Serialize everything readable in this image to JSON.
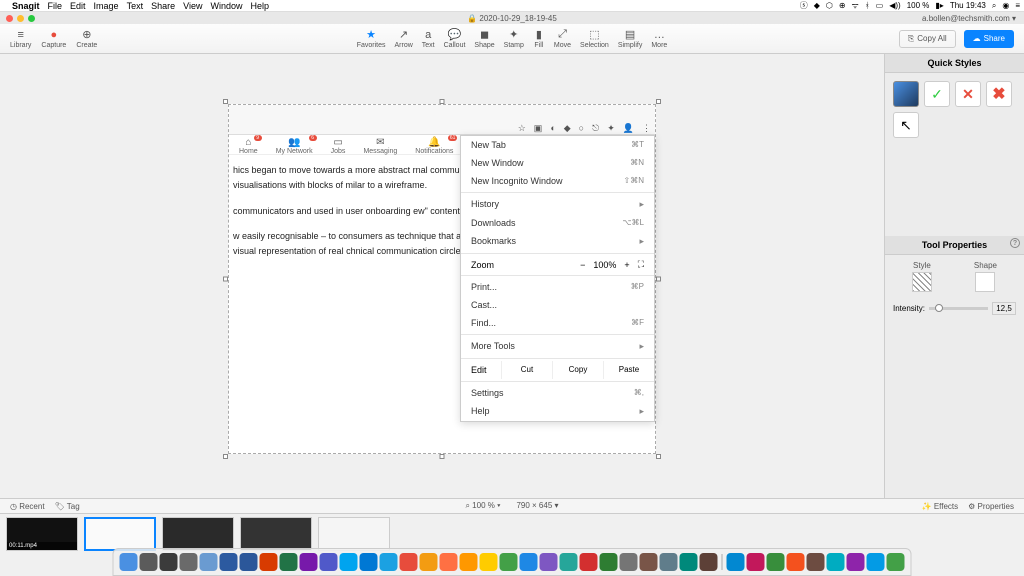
{
  "mac_menubar": {
    "app_name": "Snagit",
    "items": [
      "File",
      "Edit",
      "Image",
      "Text",
      "Share",
      "View",
      "Window",
      "Help"
    ],
    "right": {
      "battery": "100 %",
      "time": "Thu 19:43"
    }
  },
  "title_bar": {
    "title": "2020-10-29_18-19-45",
    "account": "a.bollen@techsmith.com ▾"
  },
  "toolbar": {
    "left": [
      {
        "icon": "≡",
        "label": "Library"
      },
      {
        "icon": "●",
        "label": "Capture",
        "color": "#e74c3c"
      },
      {
        "icon": "⊕",
        "label": "Create"
      }
    ],
    "center": [
      {
        "icon": "★",
        "label": "Favorites",
        "color": "#0a84ff"
      },
      {
        "icon": "↗",
        "label": "Arrow"
      },
      {
        "icon": "a",
        "label": "Text"
      },
      {
        "icon": "💬",
        "label": "Callout"
      },
      {
        "icon": "◼",
        "label": "Shape"
      },
      {
        "icon": "✦",
        "label": "Stamp"
      },
      {
        "icon": "▮",
        "label": "Fill"
      },
      {
        "icon": "⤢",
        "label": "Move"
      },
      {
        "icon": "⬚",
        "label": "Selection"
      },
      {
        "icon": "▤",
        "label": "Simplify"
      },
      {
        "icon": "…",
        "label": "More"
      }
    ],
    "copy_all": "Copy All",
    "share": "Share"
  },
  "right_panel": {
    "quick_styles_title": "Quick Styles",
    "tool_props_title": "Tool Properties",
    "style_label": "Style",
    "shape_label": "Shape",
    "intensity_label": "Intensity:",
    "intensity_value": "12,5"
  },
  "canvas": {
    "linkedin_nav": [
      {
        "label": "Home",
        "badge": "9"
      },
      {
        "label": "My Network",
        "badge": "6"
      },
      {
        "label": "Jobs",
        "badge": ""
      },
      {
        "label": "Messaging",
        "badge": ""
      },
      {
        "label": "Notifications",
        "badge": "61"
      }
    ],
    "paragraphs": [
      "hics began to move towards a more abstract rnal communications, especially among y simple visualisations with blocks of milar to a wireframe.",
      "communicators and used in user onboarding ew\" content, making its way into classic",
      "w easily recognisable – to consumers as technique that a lot of companies are using, out, simplified visual representation of real chnical communication circles it came to be"
    ]
  },
  "chrome_menu": {
    "items": [
      {
        "label": "New Tab",
        "shortcut": "⌘T"
      },
      {
        "label": "New Window",
        "shortcut": "⌘N"
      },
      {
        "label": "New Incognito Window",
        "shortcut": "⇧⌘N"
      }
    ],
    "group2": [
      {
        "label": "History",
        "arrow": "▸"
      },
      {
        "label": "Downloads",
        "shortcut": "⌥⌘L"
      },
      {
        "label": "Bookmarks",
        "arrow": "▸"
      }
    ],
    "zoom": {
      "label": "Zoom",
      "minus": "−",
      "value": "100%",
      "plus": "+",
      "full": "⛶"
    },
    "group3": [
      {
        "label": "Print...",
        "shortcut": "⌘P"
      },
      {
        "label": "Cast..."
      },
      {
        "label": "Find...",
        "shortcut": "⌘F"
      }
    ],
    "more_tools": {
      "label": "More Tools",
      "arrow": "▸"
    },
    "edit": {
      "label": "Edit",
      "cut": "Cut",
      "copy": "Copy",
      "paste": "Paste"
    },
    "group4": [
      {
        "label": "Settings",
        "shortcut": "⌘,"
      },
      {
        "label": "Help",
        "arrow": "▸"
      }
    ]
  },
  "status_bar": {
    "recent": "Recent",
    "tag": "Tag",
    "zoom": "100 %",
    "dims": "790 × 645 ▾",
    "effects": "Effects",
    "properties": "Properties"
  },
  "tray": {
    "thumbs": [
      {
        "label": "00:11.mp4"
      },
      {
        "label": ""
      },
      {
        "label": ""
      },
      {
        "label": ""
      },
      {
        "label": ""
      }
    ]
  },
  "dock_colors": [
    "#4a90e2",
    "#5b5b5b",
    "#3b3b3b",
    "#6a6a6a",
    "#6a9bd1",
    "#2c5aa0",
    "#2b579a",
    "#d83b01",
    "#217346",
    "#7719aa",
    "#5059c9",
    "#00a4ef",
    "#0078d4",
    "#1ba1e2",
    "#e74c3c",
    "#f39c12",
    "#ff7043",
    "#ff9800",
    "#ffcc00",
    "#43a047",
    "#1e88e5",
    "#7e57c2",
    "#26a69a",
    "#d32f2f",
    "#2e7d32",
    "#757575",
    "#795548",
    "#607d8b",
    "#00897b",
    "#5d4037",
    "#0288d1",
    "#c2185b",
    "#388e3c",
    "#f4511e",
    "#6d4c41",
    "#00acc1",
    "#8e24aa",
    "#039be5",
    "#43a047"
  ]
}
